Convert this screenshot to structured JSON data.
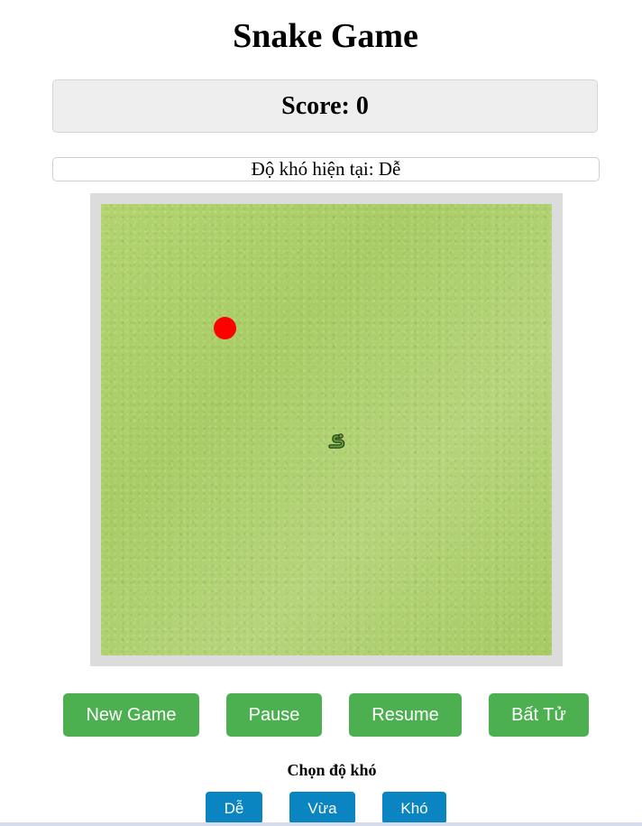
{
  "title": "Snake Game",
  "score": {
    "text": "Score: 0",
    "value": 0
  },
  "difficulty": {
    "current_text": "Độ khó hiện tại: Dễ"
  },
  "board": {
    "grid_cells": 20,
    "food": {
      "col": 5,
      "row": 5,
      "color": "#ff0000"
    },
    "snake": {
      "col": 10,
      "row": 10,
      "icon": "snake-icon"
    },
    "grass_color": "#aed06a"
  },
  "controls": {
    "new_game": "New Game",
    "pause": "Pause",
    "resume": "Resume",
    "immortal": "Bất Tử",
    "color": "#4caf50"
  },
  "level_select": {
    "label": "Chọn độ khó",
    "easy": "Dễ",
    "medium": "Vừa",
    "hard": "Khó",
    "color": "#0b84c2"
  }
}
